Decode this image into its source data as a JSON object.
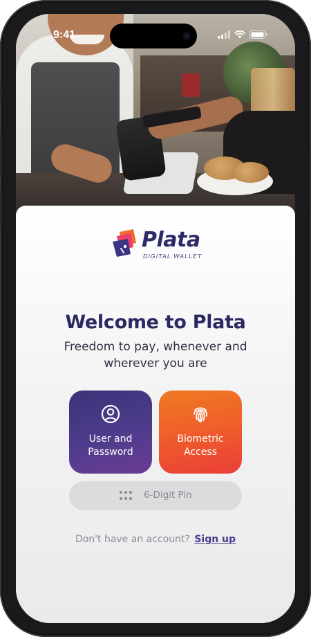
{
  "status_bar": {
    "time": "9:41"
  },
  "brand": {
    "name": "Plata",
    "tagline": "DIGITAL WALLET",
    "colors": {
      "navy": "#2b2961",
      "purple": "#4e3c8c",
      "orange": "#ef7a23",
      "red": "#ea3f38"
    }
  },
  "welcome": {
    "title": "Welcome to Plata",
    "subtitle": "Freedom to pay, whenever and wherever you are"
  },
  "login_options": [
    {
      "label": "User and Password",
      "icon": "user-circle-icon"
    },
    {
      "label": "Biometric Access",
      "icon": "fingerprint-icon"
    }
  ],
  "pin_option": {
    "label": "6-Digit Pin",
    "icon": "keypad-dots-icon"
  },
  "signup": {
    "prompt": "Don't have an account?",
    "link": "Sign up"
  }
}
